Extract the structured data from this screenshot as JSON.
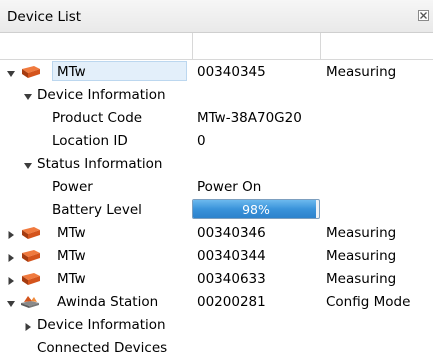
{
  "window": {
    "title": "Device List",
    "close_icon": "close-box-icon"
  },
  "rows": [
    {
      "type": "device",
      "level": 0,
      "expanded": true,
      "icon": "mtw-sensor-icon",
      "name": "MTw",
      "id": "00340345",
      "status": "Measuring",
      "selected": true
    },
    {
      "type": "group",
      "level": 1,
      "expanded": true,
      "label": "Device Information"
    },
    {
      "type": "property",
      "label": "Product Code",
      "value": "MTw-38A70G20"
    },
    {
      "type": "property",
      "label": "Location ID",
      "value": "0"
    },
    {
      "type": "group",
      "level": 1,
      "expanded": true,
      "label": "Status Information"
    },
    {
      "type": "property",
      "label": "Power",
      "value": "Power On"
    },
    {
      "type": "battery",
      "label": "Battery Level",
      "value_text": "98%",
      "fraction": 0.98
    },
    {
      "type": "device",
      "level": 0,
      "expanded": false,
      "icon": "mtw-sensor-icon",
      "name": "MTw",
      "id": "00340346",
      "status": "Measuring"
    },
    {
      "type": "device",
      "level": 0,
      "expanded": false,
      "icon": "mtw-sensor-icon",
      "name": "MTw",
      "id": "00340344",
      "status": "Measuring"
    },
    {
      "type": "device",
      "level": 0,
      "expanded": false,
      "icon": "mtw-sensor-icon",
      "name": "MTw",
      "id": "00340633",
      "status": "Measuring"
    },
    {
      "type": "device",
      "level": 0,
      "expanded": true,
      "icon": "awinda-station-icon",
      "name": "Awinda Station",
      "id": "00200281",
      "status": "Config Mode"
    },
    {
      "type": "group",
      "level": 1,
      "expanded": false,
      "label": "Device Information"
    },
    {
      "type": "plain",
      "label": "Connected Devices"
    }
  ],
  "colors": {
    "mtw": "#d4541c",
    "battery": "#3a93da",
    "selection": "#e3effa"
  }
}
